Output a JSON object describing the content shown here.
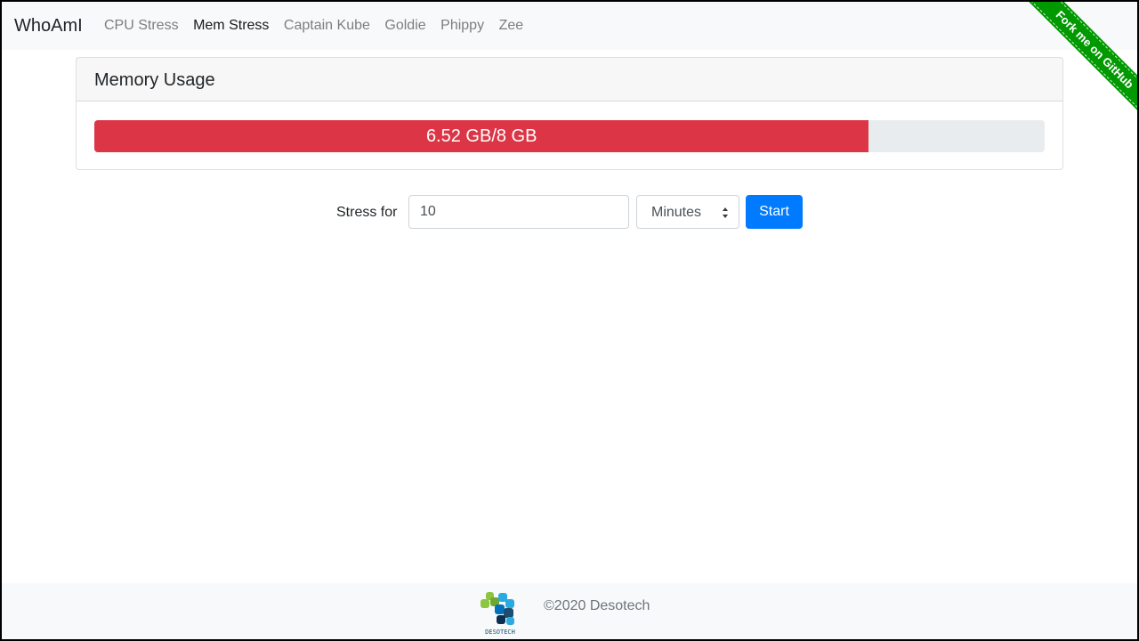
{
  "navbar": {
    "brand": "WhoAmI",
    "links": [
      {
        "label": "CPU Stress",
        "active": false
      },
      {
        "label": "Mem Stress",
        "active": true
      },
      {
        "label": "Captain Kube",
        "active": false
      },
      {
        "label": "Goldie",
        "active": false
      },
      {
        "label": "Phippy",
        "active": false
      },
      {
        "label": "Zee",
        "active": false
      }
    ]
  },
  "ribbon": {
    "label": "Fork me on GitHub",
    "color": "#009900"
  },
  "memory_card": {
    "title": "Memory Usage",
    "progress_label": "6.52 GB/8 GB",
    "progress_fraction": 0.815,
    "bar_color": "#dc3545"
  },
  "stress_form": {
    "label": "Stress for",
    "duration_value": "10",
    "unit_selected": "Minutes",
    "start_label": "Start",
    "button_color": "#007bff"
  },
  "footer": {
    "logo_text": "DESOTECH",
    "copyright": "©2020 Desotech"
  }
}
